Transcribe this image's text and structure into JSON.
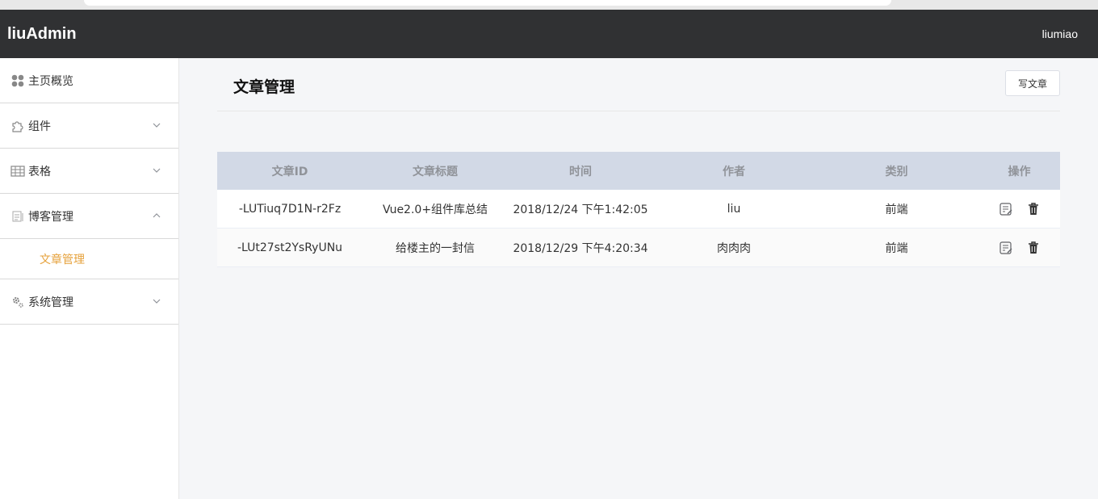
{
  "header": {
    "brand": "liuAdmin",
    "user": "liumiao"
  },
  "sidebar": {
    "items": [
      {
        "label": "主页概览",
        "icon": "dashboard-icon",
        "expanded": null
      },
      {
        "label": "组件",
        "icon": "puzzle-icon",
        "expanded": false
      },
      {
        "label": "表格",
        "icon": "table-icon",
        "expanded": false
      },
      {
        "label": "博客管理",
        "icon": "document-icon",
        "expanded": true
      },
      {
        "label": "系统管理",
        "icon": "gear-icon",
        "expanded": false
      }
    ],
    "subitems": {
      "blog": [
        {
          "label": "文章管理",
          "active": true
        }
      ]
    }
  },
  "page": {
    "title": "文章管理",
    "write_button": "写文章"
  },
  "table": {
    "columns": [
      "文章ID",
      "文章标题",
      "时间",
      "作者",
      "类别",
      "操作"
    ],
    "rows": [
      {
        "id": "-LUTiuq7D1N-r2Fz",
        "title": "Vue2.0+组件库总结",
        "time": "2018/12/24 下午1:42:05",
        "author": "liu",
        "category": "前端"
      },
      {
        "id": "-LUt27st2YsRyUNu",
        "title": "给楼主的一封信",
        "time": "2018/12/29 下午4:20:34",
        "author": "肉肉肉",
        "category": "前端"
      }
    ]
  },
  "colors": {
    "topbar": "#303133",
    "active": "#e6a23c",
    "thead": "#d2d9e6"
  }
}
